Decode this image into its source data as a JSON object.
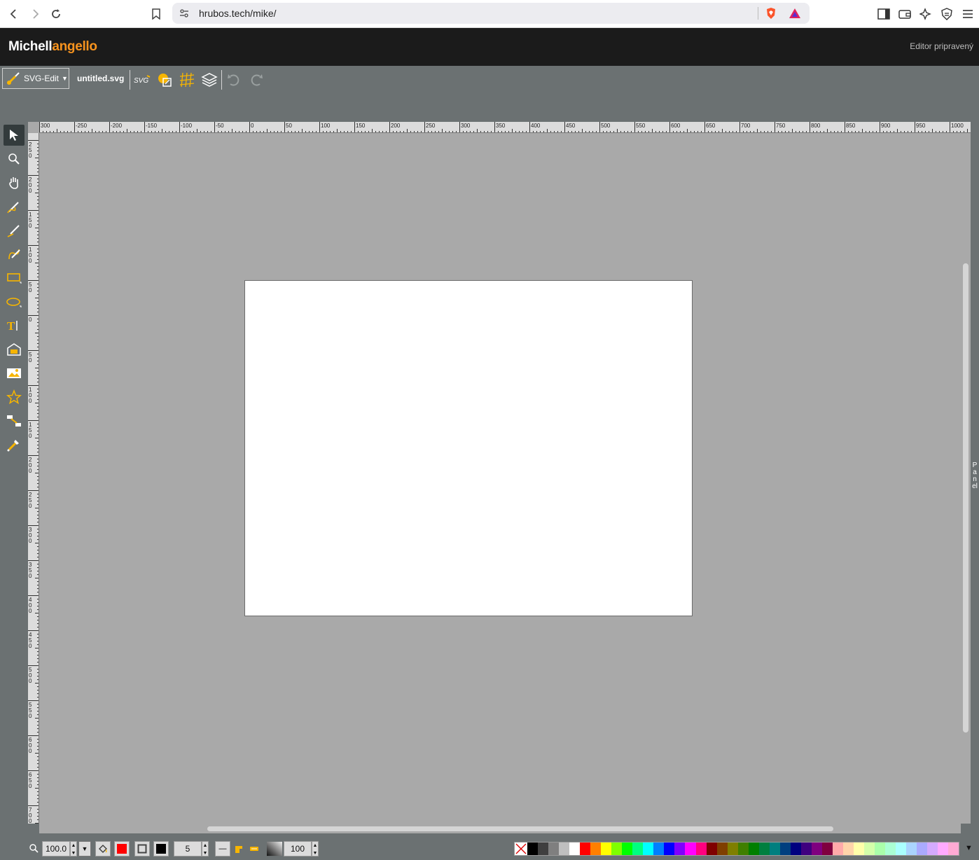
{
  "browser": {
    "url": "hrubos.tech/mike/"
  },
  "header": {
    "logo_part1": "Michell",
    "logo_part2": "angello",
    "status": "Editor pripravený"
  },
  "toolbar": {
    "main_menu_label": "SVG-Edit",
    "filename": "untitled.svg"
  },
  "ruler_top_labels": [
    "300",
    "-250",
    "-200",
    "-150",
    "-100",
    "-50",
    "0",
    "50",
    "100",
    "150",
    "200",
    "250",
    "300",
    "350",
    "400",
    "450",
    "500",
    "550",
    "600",
    "650",
    "700",
    "750",
    "800",
    "850",
    "900",
    "950",
    "1000"
  ],
  "ruler_left_labels": [
    "250",
    "200",
    "150",
    "100",
    "50",
    "0",
    "50",
    "100",
    "150",
    "200",
    "250",
    "300",
    "350",
    "400",
    "450",
    "500",
    "550",
    "600",
    "650",
    "700",
    "750"
  ],
  "side_panel": {
    "label": "Panel"
  },
  "bottom": {
    "zoom_value": "100.0",
    "stroke_width": "5",
    "opacity": "100",
    "fill_color": "#ff0000",
    "stroke_color": "#000000"
  },
  "palette": [
    "#000000",
    "#3f3f3f",
    "#7f7f7f",
    "#bfbfbf",
    "#ffffff",
    "#ff0000",
    "#ff7f00",
    "#ffff00",
    "#7fff00",
    "#00ff00",
    "#00ff7f",
    "#00ffff",
    "#007fff",
    "#0000ff",
    "#7f00ff",
    "#ff00ff",
    "#ff007f",
    "#7f0000",
    "#7f3f00",
    "#7f7f00",
    "#3f7f00",
    "#007f00",
    "#007f3f",
    "#007f7f",
    "#003f7f",
    "#00007f",
    "#3f007f",
    "#7f007f",
    "#7f003f",
    "#ffaaaa",
    "#ffd4aa",
    "#ffffaa",
    "#d4ffaa",
    "#aaffaa",
    "#aaffd4",
    "#aaffff",
    "#aad4ff",
    "#aaaaff",
    "#d4aaff",
    "#ffaaff",
    "#ffaad4"
  ]
}
